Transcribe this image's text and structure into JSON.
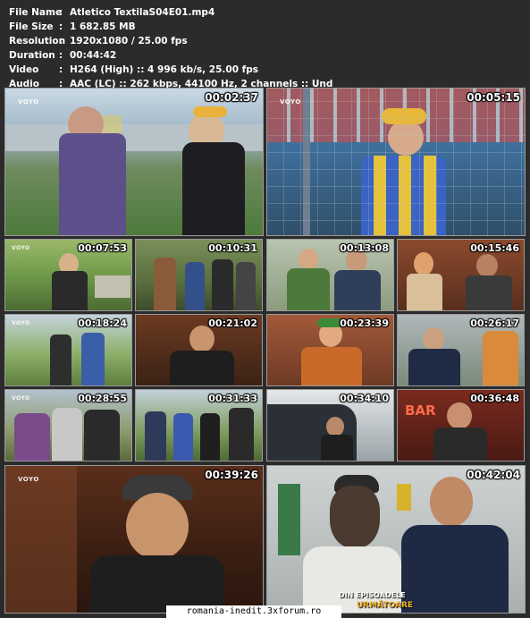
{
  "info": [
    {
      "key": "File Name",
      "sep": ":",
      "value": "Atletico TextilaS04E01.mp4"
    },
    {
      "key": "File Size",
      "sep": ":",
      "value": "1 682.85 MB"
    },
    {
      "key": "Resolution",
      "sep": ":",
      "value": "1920x1080 / 25.00 fps"
    },
    {
      "key": "Duration",
      "sep": ":",
      "value": "00:44:42"
    },
    {
      "key": "Video",
      "sep": ":",
      "value": "H264 (High) :: 4 996 kb/s, 25.00 fps"
    },
    {
      "key": "Audio",
      "sep": ":",
      "value": "AAC (LC) :: 262 kbps, 44100 Hz, 2 channels :: Und"
    }
  ],
  "logo": "VOYO",
  "thumbnails": [
    {
      "time": "00:02:37"
    },
    {
      "time": "00:05:15"
    },
    {
      "time": "00:07:53"
    },
    {
      "time": "00:10:31"
    },
    {
      "time": "00:13:08"
    },
    {
      "time": "00:15:46"
    },
    {
      "time": "00:18:24"
    },
    {
      "time": "00:21:02"
    },
    {
      "time": "00:23:39"
    },
    {
      "time": "00:26:17"
    },
    {
      "time": "00:28:55"
    },
    {
      "time": "00:31:33"
    },
    {
      "time": "00:34:10"
    },
    {
      "time": "00:36:48"
    },
    {
      "time": "00:39:26"
    },
    {
      "time": "00:42:04"
    }
  ],
  "scene_text": {
    "bar_sign": "BAR",
    "caption_line1": "DIN EPISOADELE",
    "caption_line2": "URMĂTOARE"
  },
  "footer": "romania-inedit.3xforum.ro"
}
